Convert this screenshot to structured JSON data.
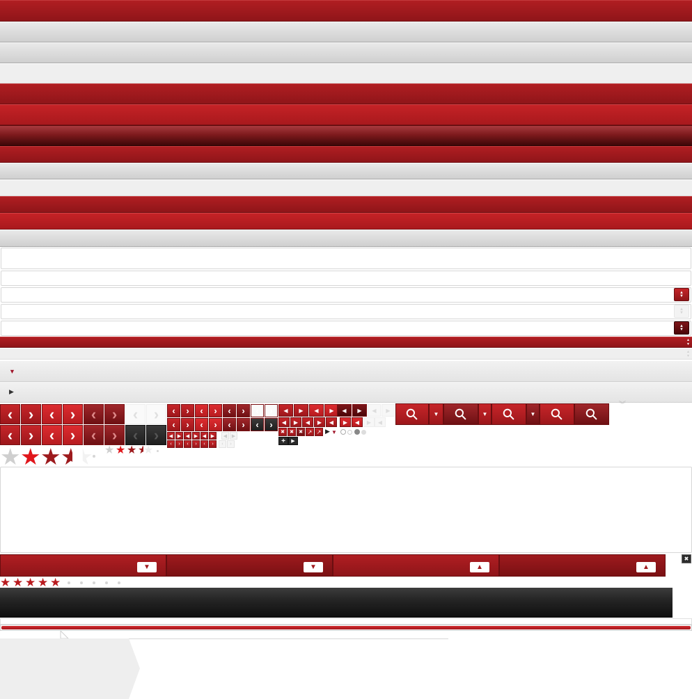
{
  "colors": {
    "accent": "#b01e22",
    "accent_bright": "#c52226",
    "accent_dark": "#7e1a1d",
    "grey": "#d8d8d8",
    "light": "#efefef"
  },
  "icons": {
    "chevron_left": "‹",
    "chevron_right": "›",
    "triangle_up": "▲",
    "triangle_down": "▼",
    "triangle_right": "▶",
    "triangle_left": "◀",
    "search": "⚲",
    "star": "★",
    "close": "✖",
    "plus": "+",
    "expand": "↗"
  },
  "spinner": {
    "up": "▲",
    "down": "▼"
  },
  "accordion": {
    "expanded_arrow": "▼",
    "collapsed_arrow": "▶"
  },
  "ratings": {
    "large": {
      "value": 3.5,
      "max": 5
    },
    "small": {
      "value": 3.5,
      "max": 5
    },
    "full": {
      "value": 5,
      "max": 5
    }
  }
}
